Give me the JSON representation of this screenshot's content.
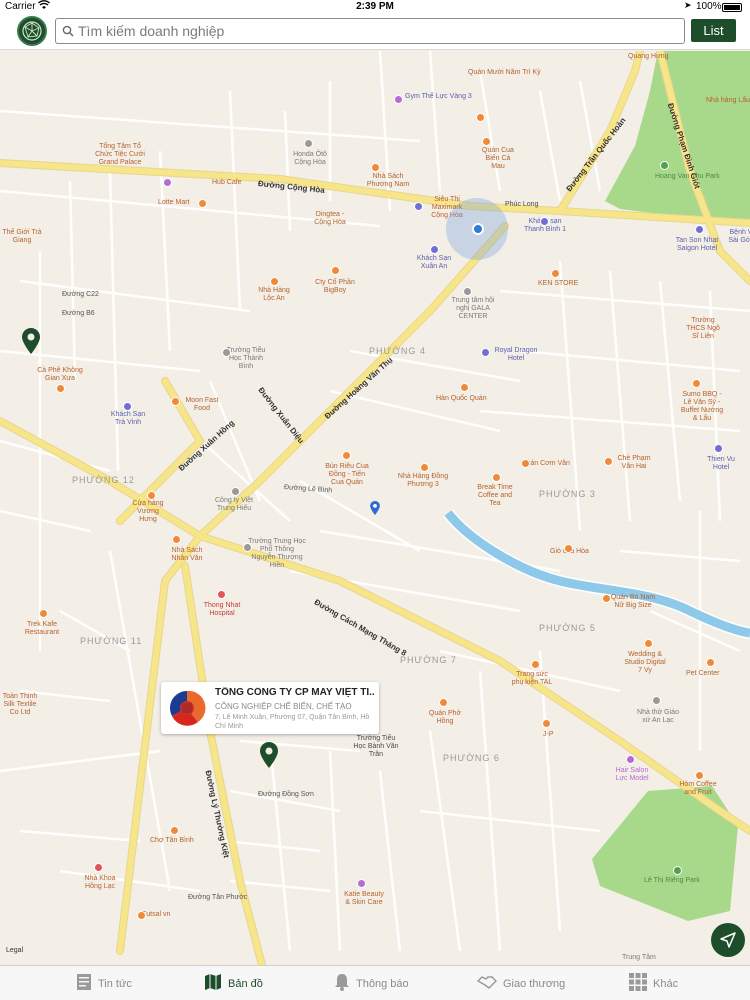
{
  "status_bar": {
    "carrier": "Carrier",
    "time": "2:39 PM",
    "battery": "100%"
  },
  "search": {
    "placeholder": "Tìm kiếm doanh nghiệp",
    "value": ""
  },
  "toolbar": {
    "list_label": "List"
  },
  "colors": {
    "accent": "#1e4d2b",
    "map_background": "#f3efe6",
    "park": "#a8d98a",
    "river": "#8ec9ea",
    "major_road": "#f7e58a",
    "location": "#2f7be0"
  },
  "map": {
    "wards": [
      "PHƯỜNG 4",
      "PHƯỜNG 12",
      "PHƯỜNG 3",
      "PHƯỜNG 11",
      "PHƯỜNG 5",
      "PHƯỜNG 7",
      "PHƯỜNG 6"
    ],
    "roads": {
      "cong_hoa": "Đường Cộng Hòa",
      "tran_quoc_hoan": "Đường Trần Quốc Hoàn",
      "pham_dinh_giot": "Đường Phạm Đình Giót",
      "hoang_van_thu": "Đường Hoàng Văn Thụ",
      "xuan_dieu": "Đường Xuân Diệu",
      "xuan_hong": "Đường Xuân Hồng",
      "cach_mang_thang_8": "Đường Cách Mạng Tháng 8",
      "ly_thuong_kiet": "Đường Lý Thường Kiệt",
      "c22": "Đường C22",
      "b6": "Đường B6",
      "le_binh": "Đường Lê Bình",
      "dong_son": "Đường Đồng Sơn",
      "tan_phuoc": "Đường Tân Phước"
    },
    "places": [
      {
        "name": "Quán Mười Năm Trì Kỳ"
      },
      {
        "name": "Quang Hưng"
      },
      {
        "name": "Nhà hàng Lẩu Dê Vàng"
      },
      {
        "name": "Gym Thể Lực Vàng 3"
      },
      {
        "name": "Tổng Tâm Tổ Chức Tiệc Cưới Grand Palace"
      },
      {
        "name": "Honda Ôtô Cộng Hòa"
      },
      {
        "name": "Quán Cua Biển Cà Mau"
      },
      {
        "name": "Nhà Sách Phương Nam"
      },
      {
        "name": "Hub Cafe"
      },
      {
        "name": "Lotte Mart"
      },
      {
        "name": "Siêu Thị Maximark Cộng Hòa"
      },
      {
        "name": "Phúc Long"
      },
      {
        "name": "Hoang Van Thu Park"
      },
      {
        "name": "Dingtea - Cộng Hòa"
      },
      {
        "name": "Khách sạn Thanh Bình 1"
      },
      {
        "name": "Tan Son Nhat Saigon Hotel"
      },
      {
        "name": "Bệnh V Sài Gòn"
      },
      {
        "name": "Thế Giới Trà Giang"
      },
      {
        "name": "Khách Sạn Xuân An"
      },
      {
        "name": "Cty Cổ Phần BigBoy"
      },
      {
        "name": "Nhà Hàng Lộc An"
      },
      {
        "name": "KEN STORE"
      },
      {
        "name": "Trung tâm hội nghị GALA CENTER"
      },
      {
        "name": "Trường THCS Ngô Sĩ Liên"
      },
      {
        "name": "Trường Tiểu Học Thành Bình"
      },
      {
        "name": "Royal Dragon Hotel"
      },
      {
        "name": "Cà Phê Không Gian Xưa"
      },
      {
        "name": "Moon Fast Food"
      },
      {
        "name": "Khách Sạn Trà Vinh"
      },
      {
        "name": "Hàn Quốc Quán"
      },
      {
        "name": "Sumo BBQ - Lê Văn Sỹ - Buffet Nướng & Lẩu"
      },
      {
        "name": "Thien Vu Hotel"
      },
      {
        "name": "Bún Riêu Cua Đồng - Tiến Cua Quán"
      },
      {
        "name": "Nhà Hàng Đồng Phương 3"
      },
      {
        "name": "Quán Cơm Văn"
      },
      {
        "name": "Chè Phạm Văn Hai"
      },
      {
        "name": "Break Time Coffee and Tea"
      },
      {
        "name": "Công ty Việt Trung Hiếu"
      },
      {
        "name": "Cửa hàng Vương Hưng"
      },
      {
        "name": "Giò chả Hòa"
      },
      {
        "name": "Trường Trung Học Phổ Thông Nguyễn Thượng Hiền"
      },
      {
        "name": "Nhà Sách Nhân Văn"
      },
      {
        "name": "Thong Nhat Hospital"
      },
      {
        "name": "Quán Bò Nam Nữ Big Size"
      },
      {
        "name": "Trek Kafe Restaurant"
      },
      {
        "name": "Wedding & Studio Digital 7 Vy"
      },
      {
        "name": "Trang sức phụ kiện TAL"
      },
      {
        "name": "Pet Center"
      },
      {
        "name": "Toàn Thịnh Silk Textile Co Ltd"
      },
      {
        "name": "Quán Phở Hồng"
      },
      {
        "name": "J-P"
      },
      {
        "name": "Nhà thờ Giáo xứ An Lạc"
      },
      {
        "name": "Trường Tiểu Học Bành Văn Trân"
      },
      {
        "name": "Hair Salon Lực Model"
      },
      {
        "name": "Chợ Tân Bình"
      },
      {
        "name": "Hòm Coffee and Fruit"
      },
      {
        "name": "Lê Thị Riêng Park"
      },
      {
        "name": "Nhà Khoa Hồng Lạc"
      },
      {
        "name": "Katie Beauty & Skin Care"
      },
      {
        "name": "Futsal vn"
      },
      {
        "name": "Trung Tâm"
      }
    ],
    "legal": "Legal"
  },
  "callout": {
    "title": "TỔNG CÔNG TY CP MAY VIỆT TI...",
    "subtitle": "CÔNG NGHIỆP CHẾ BIẾN, CHẾ TẠO",
    "address": "7, Lê Minh Xuân, Phường 07, Quận Tân Bình, Hồ Chí Minh"
  },
  "tabs": [
    {
      "label": "Tin tức",
      "icon": "news-icon"
    },
    {
      "label": "Bản đồ",
      "icon": "map-icon"
    },
    {
      "label": "Thông báo",
      "icon": "bell-icon"
    },
    {
      "label": "Giao thương",
      "icon": "handshake-icon"
    },
    {
      "label": "Khác",
      "icon": "grid-icon"
    }
  ]
}
